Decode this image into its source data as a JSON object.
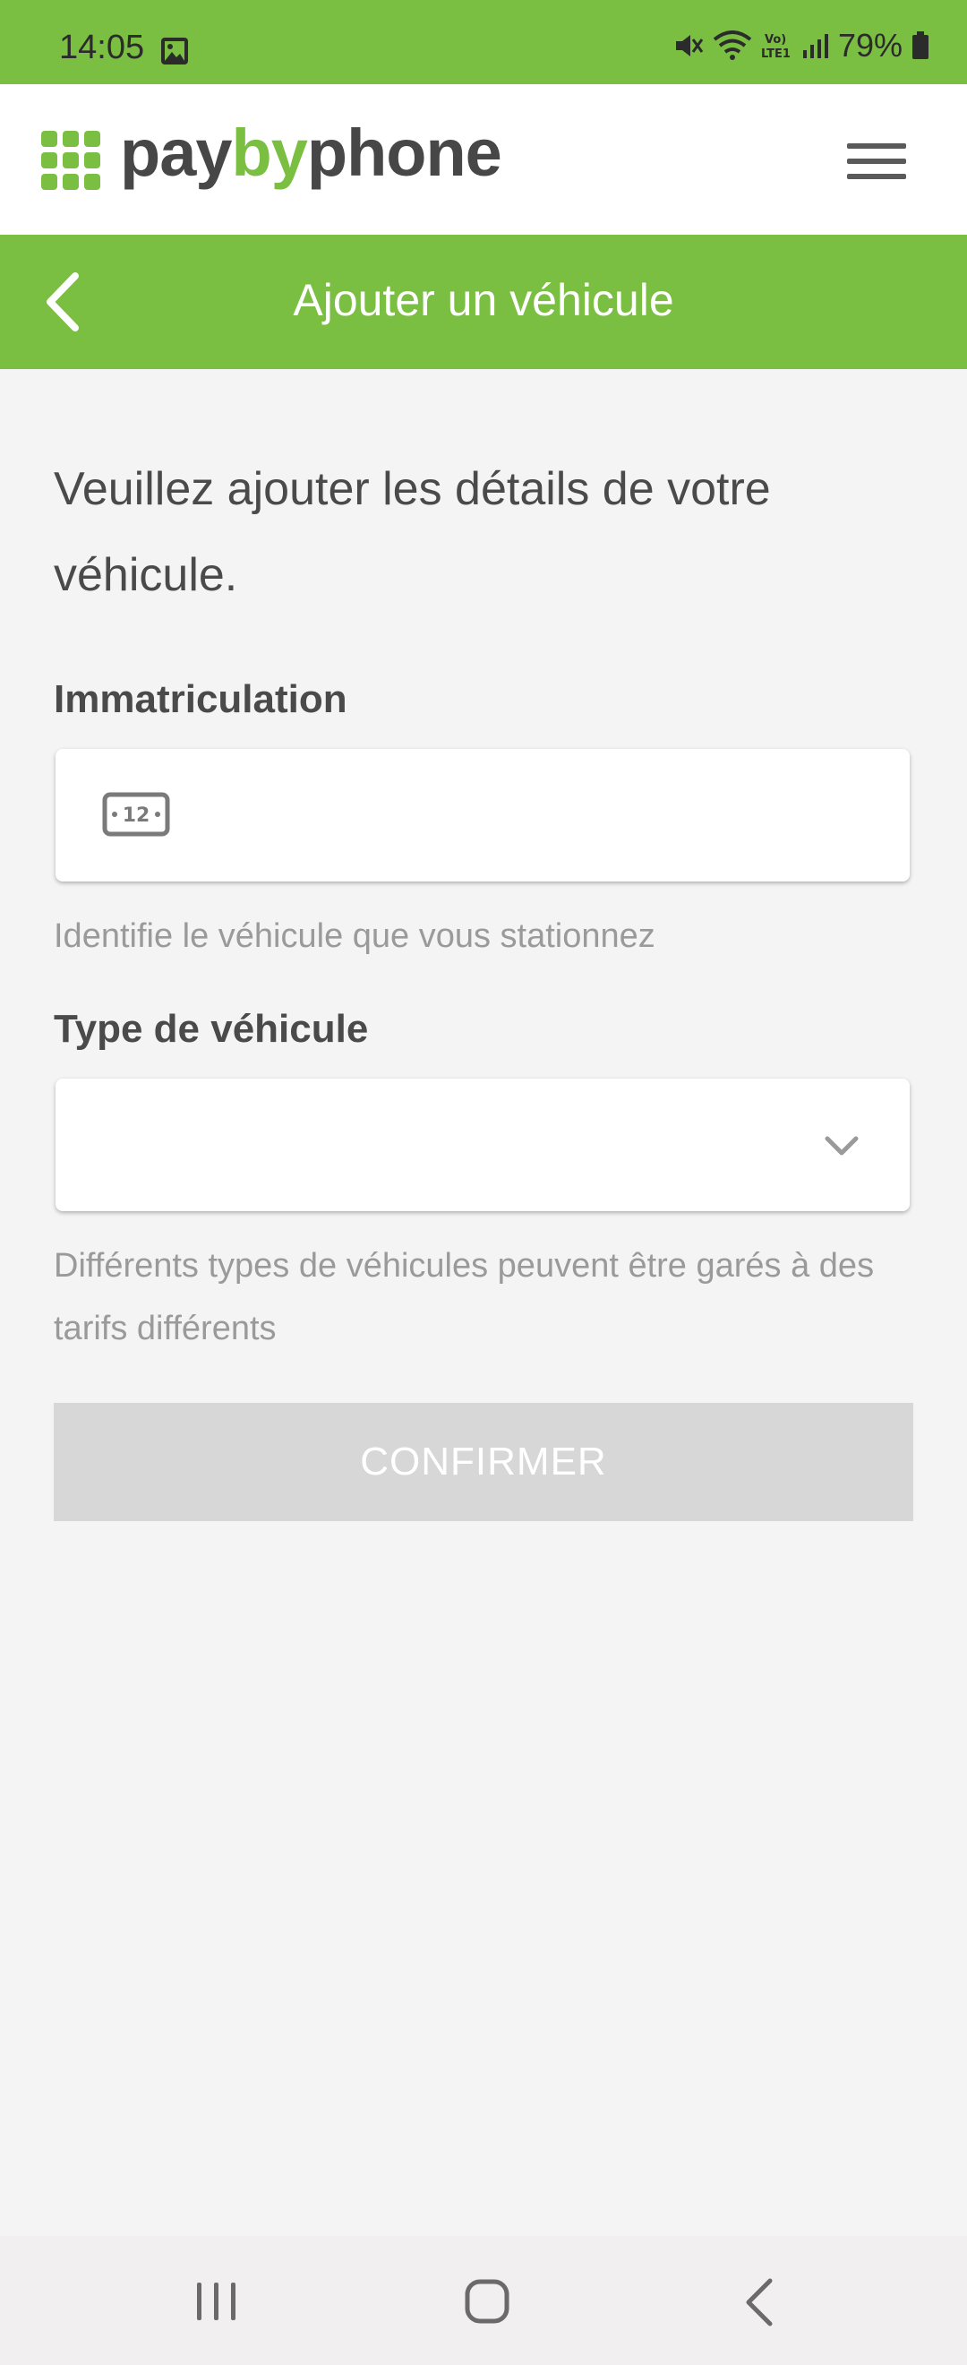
{
  "status_bar": {
    "time": "14:05",
    "battery": "79%",
    "icons": [
      "gallery-icon",
      "mute-icon",
      "wifi-icon",
      "volte-icon",
      "signal-icon",
      "battery-icon"
    ]
  },
  "header": {
    "logo_pay": "pay",
    "logo_by": "by",
    "logo_phone": "phone",
    "menu_icon": "hamburger-menu-icon"
  },
  "title_bar": {
    "title": "Ajouter un véhicule",
    "back_icon": "back-arrow-icon"
  },
  "form": {
    "intro": "Veuillez ajouter les détails de votre véhicule.",
    "plate": {
      "label": "Immatriculation",
      "value": "",
      "icon": "license-plate-icon",
      "helper": "Identifie le véhicule que vous stationnez"
    },
    "vehicle_type": {
      "label": "Type de véhicule",
      "value": "",
      "icon": "chevron-down-icon",
      "helper": "Différents types de véhicules peuvent être garés à des tarifs différents"
    },
    "confirm_label": "CONFIRMER"
  },
  "nav_bar": {
    "icons": [
      "recent-apps-icon",
      "home-icon",
      "back-icon"
    ]
  },
  "colors": {
    "brand_green": "#7abf42",
    "text_dark": "#4a4a4a",
    "helper_gray": "#9a9a9a",
    "disabled_button": "#d7d7d7",
    "background": "#f4f4f4"
  }
}
